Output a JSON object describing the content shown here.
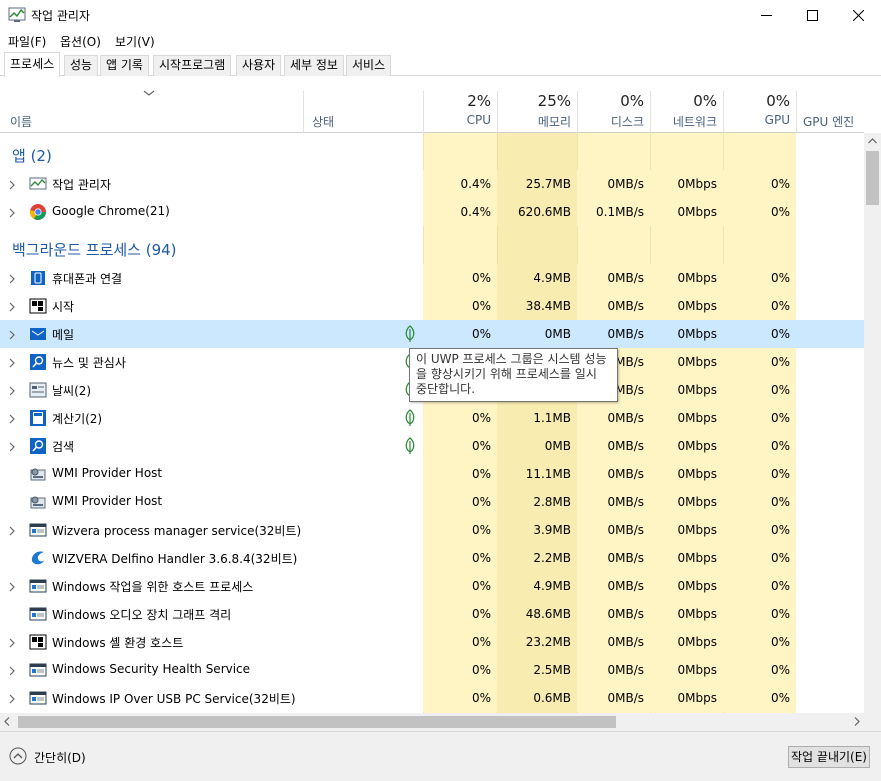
{
  "window": {
    "title": "작업 관리자"
  },
  "menu": [
    "파일(F)",
    "옵션(O)",
    "보기(V)"
  ],
  "tabs": [
    "프로세스",
    "성능",
    "앱 기록",
    "시작프로그램",
    "사용자",
    "세부 정보",
    "서비스"
  ],
  "header": {
    "name": "이름",
    "status": "상태",
    "cpu": {
      "pct": "2%",
      "label": "CPU"
    },
    "memory": {
      "pct": "25%",
      "label": "메모리"
    },
    "disk": {
      "pct": "0%",
      "label": "디스크"
    },
    "network": {
      "pct": "0%",
      "label": "네트워크"
    },
    "gpu": {
      "pct": "0%",
      "label": "GPU"
    },
    "gpu_engine": {
      "label": "GPU 엔진"
    }
  },
  "groups": {
    "apps": "앱 (2)",
    "background": "백그라운드 프로세스 (94)"
  },
  "apps": [
    {
      "name": "작업 관리자",
      "cpu": "0.4%",
      "mem": "25.7MB",
      "disk": "0MB/s",
      "net": "0Mbps",
      "gpu": "0%"
    },
    {
      "name": "Google Chrome(21)",
      "cpu": "0.4%",
      "mem": "620.6MB",
      "disk": "0.1MB/s",
      "net": "0Mbps",
      "gpu": "0%"
    }
  ],
  "background": [
    {
      "name": "휴대폰과 연결",
      "cpu": "0%",
      "mem": "4.9MB",
      "disk": "0MB/s",
      "net": "0Mbps",
      "gpu": "0%"
    },
    {
      "name": "시작",
      "cpu": "0%",
      "mem": "38.4MB",
      "disk": "0MB/s",
      "net": "0Mbps",
      "gpu": "0%"
    },
    {
      "name": "메일",
      "cpu": "0%",
      "mem": "0MB",
      "disk": "0MB/s",
      "net": "0Mbps",
      "gpu": "0%"
    },
    {
      "name": "뉴스 및 관심사",
      "cpu": "",
      "mem": "",
      "disk": "MB/s",
      "net": "0Mbps",
      "gpu": "0%"
    },
    {
      "name": "날씨(2)",
      "cpu": "",
      "mem": "",
      "disk": "MB/s",
      "net": "0Mbps",
      "gpu": "0%"
    },
    {
      "name": "계산기(2)",
      "cpu": "0%",
      "mem": "1.1MB",
      "disk": "0MB/s",
      "net": "0Mbps",
      "gpu": "0%"
    },
    {
      "name": "검색",
      "cpu": "0%",
      "mem": "0MB",
      "disk": "0MB/s",
      "net": "0Mbps",
      "gpu": "0%"
    },
    {
      "name": "WMI Provider Host",
      "cpu": "0%",
      "mem": "11.1MB",
      "disk": "0MB/s",
      "net": "0Mbps",
      "gpu": "0%"
    },
    {
      "name": "WMI Provider Host",
      "cpu": "0%",
      "mem": "2.8MB",
      "disk": "0MB/s",
      "net": "0Mbps",
      "gpu": "0%"
    },
    {
      "name": "Wizvera process manager service(32비트)",
      "cpu": "0%",
      "mem": "3.9MB",
      "disk": "0MB/s",
      "net": "0Mbps",
      "gpu": "0%"
    },
    {
      "name": "WIZVERA Delfino Handler 3.6.8.4(32비트)",
      "cpu": "0%",
      "mem": "2.2MB",
      "disk": "0MB/s",
      "net": "0Mbps",
      "gpu": "0%"
    },
    {
      "name": "Windows 작업을 위한 호스트 프로세스",
      "cpu": "0%",
      "mem": "4.9MB",
      "disk": "0MB/s",
      "net": "0Mbps",
      "gpu": "0%"
    },
    {
      "name": "Windows 오디오 장치 그래프 격리",
      "cpu": "0%",
      "mem": "48.6MB",
      "disk": "0MB/s",
      "net": "0Mbps",
      "gpu": "0%"
    },
    {
      "name": "Windows 셸 환경 호스트",
      "cpu": "0%",
      "mem": "23.2MB",
      "disk": "0MB/s",
      "net": "0Mbps",
      "gpu": "0%"
    },
    {
      "name": "Windows Security Health Service",
      "cpu": "0%",
      "mem": "2.5MB",
      "disk": "0MB/s",
      "net": "0Mbps",
      "gpu": "0%"
    },
    {
      "name": "Windows IP Over USB PC Service(32비트)",
      "cpu": "0%",
      "mem": "0.6MB",
      "disk": "0MB/s",
      "net": "0Mbps",
      "gpu": "0%"
    }
  ],
  "tooltip": "이 UWP 프로세스 그룹은 시스템 성능을 향상시키기 위해 프로세스를 일시 중단합니다.",
  "footer": {
    "fewer_details": "간단히(D)",
    "end_task": "작업 끝내기(E)"
  },
  "colors": {
    "group_text": "#1e5aa8",
    "selection": "#cce8ff",
    "heat_light": "#fff4c4",
    "heat_mem": "#f9ecb0"
  }
}
